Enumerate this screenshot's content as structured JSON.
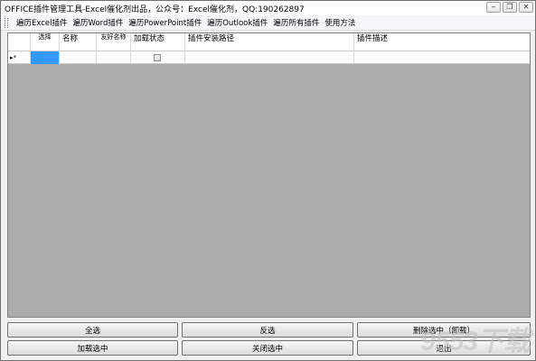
{
  "window": {
    "title": "OFFICE插件管理工具-Excel催化剂出品，公众号：Excel催化剂，QQ:190262897",
    "minimize_icon": "minimize-icon",
    "restore_icon": "restore-icon",
    "close_icon": "close-icon"
  },
  "menu": {
    "items": [
      {
        "label": "遍历Excel插件"
      },
      {
        "label": "遍历Word插件"
      },
      {
        "label": "遍历PowerPoint插件"
      },
      {
        "label": "遍历Outlook插件"
      },
      {
        "label": "遍历所有插件"
      },
      {
        "label": "使用方法"
      }
    ]
  },
  "grid": {
    "columns": [
      {
        "label": "选择"
      },
      {
        "label": "名称"
      },
      {
        "label": "友好名称"
      },
      {
        "label": "加载状态"
      },
      {
        "label": "插件安装路径"
      },
      {
        "label": "插件描述"
      }
    ],
    "row_marker": "▸*",
    "new_row": {
      "checked": false
    }
  },
  "buttons": {
    "select_all": "全选",
    "invert": "反选",
    "delete_selected": "删除选中（卸载）",
    "load_selected": "加载选中",
    "close_selected": "关闭选中",
    "exit": "退出"
  },
  "colors": {
    "grid_background": "#ababab",
    "selected_cell": "#3399ff"
  },
  "watermark": "9553下载"
}
